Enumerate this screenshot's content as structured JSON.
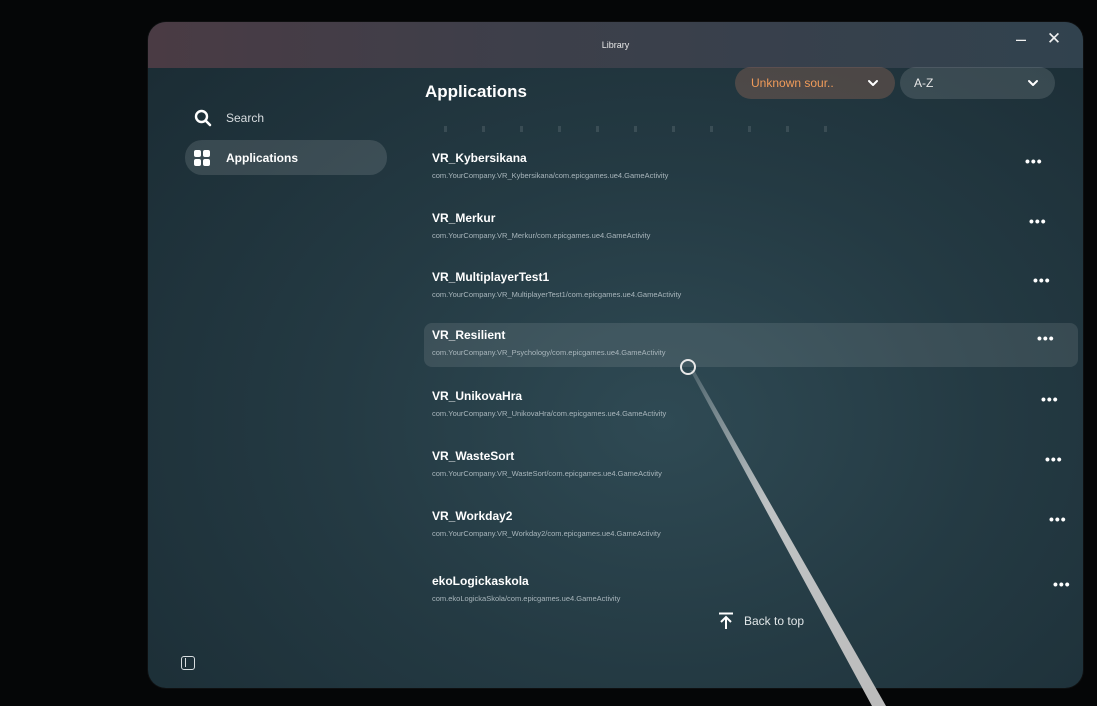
{
  "window": {
    "title": "Library",
    "minimize_label": "–",
    "close_label": "✕"
  },
  "sidebar": {
    "search_label": "Search",
    "items": [
      {
        "label": "Applications",
        "icon": "grid-icon",
        "active": true
      }
    ]
  },
  "header": {
    "title": "Applications",
    "source_filter": {
      "value": "Unknown sour..",
      "color": "#f09b5a"
    },
    "sort": {
      "value": "A-Z"
    }
  },
  "apps": [
    {
      "name": "VR_Kybersikana",
      "package": "com.YourCompany.VR_Kybersikana/com.epicgames.ue4.GameActivity"
    },
    {
      "name": "VR_Merkur",
      "package": "com.YourCompany.VR_Merkur/com.epicgames.ue4.GameActivity"
    },
    {
      "name": "VR_MultiplayerTest1",
      "package": "com.YourCompany.VR_MultiplayerTest1/com.epicgames.ue4.GameActivity"
    },
    {
      "name": "VR_Resilient",
      "package": "com.YourCompany.VR_Psychology/com.epicgames.ue4.GameActivity",
      "highlighted": true
    },
    {
      "name": "VR_UnikovaHra",
      "package": "com.YourCompany.VR_UnikovaHra/com.epicgames.ue4.GameActivity"
    },
    {
      "name": "VR_WasteSort",
      "package": "com.YourCompany.VR_WasteSort/com.epicgames.ue4.GameActivity"
    },
    {
      "name": "VR_Workday2",
      "package": "com.YourCompany.VR_Workday2/com.epicgames.ue4.GameActivity"
    },
    {
      "name": "ekoLogickaskola",
      "package": "com.ekoLogickaSkola/com.epicgames.ue4.GameActivity"
    }
  ],
  "more_label": "•••",
  "back_to_top_label": "Back to top"
}
